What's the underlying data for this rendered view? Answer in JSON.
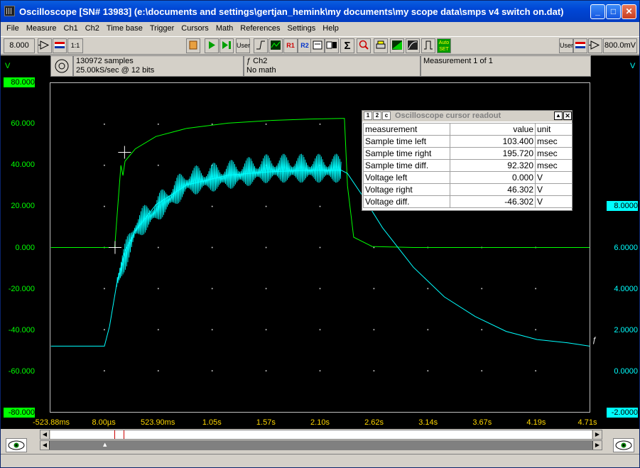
{
  "window": {
    "title": "Oscilloscope  [SN# 13983]  (e:\\documents and settings\\gertjan_hemink\\my documents\\my scope data\\smps v4 switch on.dat)"
  },
  "titlebar": {
    "min": "_",
    "max": "□",
    "close": "✕"
  },
  "menu": [
    "File",
    "Measure",
    "Ch1",
    "Ch2",
    "Time base",
    "Trigger",
    "Cursors",
    "Math",
    "References",
    "Settings",
    "Help"
  ],
  "toolbar": {
    "ch1_range": "8.000",
    "ch1_ratio": "1:1",
    "ch2_range": "800.0mV",
    "user_left": "User",
    "user_right": "User",
    "r1": "R1",
    "r2": "R2",
    "auto_set": "Auto SET"
  },
  "infobar": {
    "samples": "130972 samples",
    "rate": "25.00kS/sec @ 12 bits",
    "ch": "ƒ Ch2",
    "math": "No math",
    "measurement": "Measurement 1 of 1"
  },
  "axes": {
    "left_unit": "V",
    "right_unit": "V",
    "left_ticks": [
      "80.000",
      "60.000",
      "40.000",
      "20.000",
      "0.000",
      "-20.000",
      "-40.000",
      "-60.000",
      "-80.000"
    ],
    "right_ticks": [
      "8.0000",
      "6.0000",
      "4.0000",
      "2.0000",
      "0.0000",
      "-2.0000"
    ],
    "x_ticks": [
      "-523.88ms",
      "8.00µs",
      "523.90ms",
      "1.05s",
      "1.57s",
      "2.10s",
      "2.62s",
      "3.14s",
      "3.67s",
      "4.19s",
      "4.71s"
    ],
    "trigger_mark": "ƒ"
  },
  "colors": {
    "ch1": "#00ff00",
    "ch2": "#00ffff",
    "time_axis": "#ffd700",
    "grid": "#c0c0c0"
  },
  "readout": {
    "title": "Oscilloscope cursor readout",
    "headers": [
      "measurement",
      "value",
      "unit"
    ],
    "rows": [
      {
        "m": "Sample time left",
        "v": "103.400",
        "u": "msec"
      },
      {
        "m": "Sample time right",
        "v": "195.720",
        "u": "msec"
      },
      {
        "m": "Sample time diff.",
        "v": "92.320",
        "u": "msec"
      },
      {
        "m": "Voltage left",
        "v": "0.000",
        "u": "V"
      },
      {
        "m": "Voltage right",
        "v": "46.302",
        "u": "V"
      },
      {
        "m": "Voltage diff.",
        "v": "-46.302",
        "u": "V"
      }
    ]
  },
  "chart_data": {
    "type": "line",
    "xlim_s": [
      -0.52388,
      4.71
    ],
    "series": [
      {
        "name": "Ch1",
        "axis": "left",
        "ylim": [
          -80,
          80
        ],
        "x": [
          -0.52,
          0.1,
          0.13,
          0.16,
          0.18,
          0.2,
          0.3,
          0.5,
          0.8,
          1.2,
          1.6,
          2.0,
          2.3,
          2.33,
          2.36,
          2.42,
          2.6,
          3.0,
          3.5,
          4.0,
          4.71
        ],
        "y": [
          0,
          0,
          20,
          40,
          35,
          42,
          48,
          54,
          58,
          60.5,
          61.8,
          62.5,
          62.8,
          62.8,
          30,
          5,
          0.5,
          0,
          0,
          0,
          0
        ]
      },
      {
        "name": "Ch2",
        "axis": "right",
        "ylim": [
          -2,
          8
        ],
        "x": [
          -0.52,
          0.0,
          0.05,
          0.12,
          0.2,
          0.3,
          0.5,
          0.8,
          1.2,
          1.6,
          2.0,
          2.3,
          2.36,
          2.5,
          2.7,
          3.0,
          3.3,
          3.6,
          3.9,
          4.2,
          4.5,
          4.71
        ],
        "y": [
          0,
          0,
          0.6,
          1.9,
          2.9,
          3.5,
          4.3,
          4.9,
          5.2,
          5.3,
          5.35,
          5.35,
          5.25,
          4.6,
          3.6,
          2.4,
          1.5,
          0.9,
          0.45,
          0.2,
          0.1,
          0.0
        ]
      }
    ]
  }
}
